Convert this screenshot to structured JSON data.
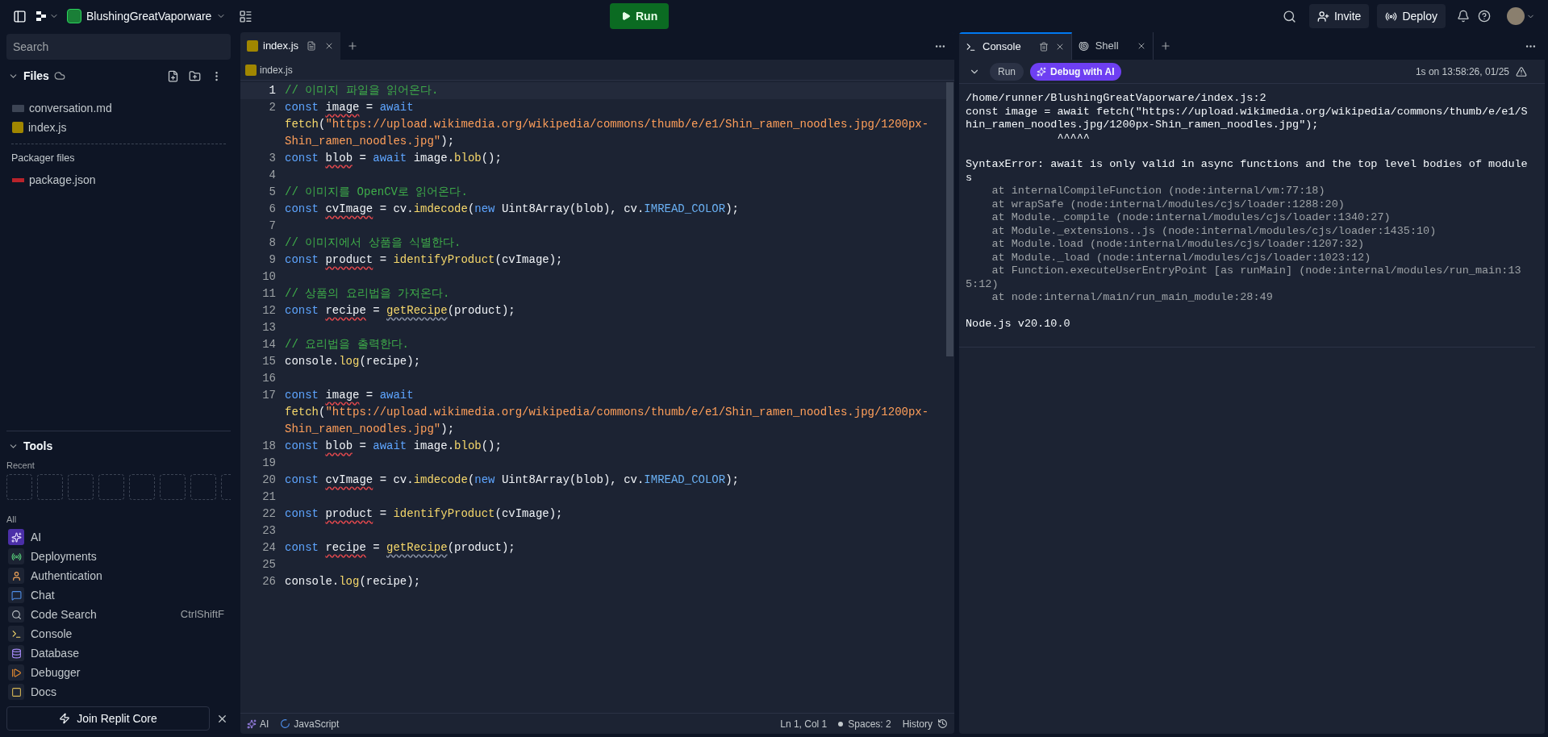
{
  "topbar": {
    "project_name": "BlushingGreatVaporware",
    "run_button": "Run",
    "invite_button": "Invite",
    "deploy_button": "Deploy"
  },
  "sidebar": {
    "search": {
      "placeholder": "Search"
    },
    "files_header": "Files",
    "files": [
      {
        "name": "conversation.md",
        "kind": "markdown"
      },
      {
        "name": "index.js",
        "kind": "js"
      }
    ],
    "packager_header": "Packager files",
    "packager_files": [
      {
        "name": "package.json",
        "kind": "npm"
      }
    ],
    "tools_header": "Tools",
    "recent_label": "Recent",
    "all_label": "All",
    "tools": [
      {
        "label": "AI"
      },
      {
        "label": "Deployments"
      },
      {
        "label": "Authentication"
      },
      {
        "label": "Chat"
      },
      {
        "label": "Code Search",
        "shortcut": "CtrlShiftF"
      },
      {
        "label": "Console"
      },
      {
        "label": "Database"
      },
      {
        "label": "Debugger"
      },
      {
        "label": "Docs"
      }
    ],
    "join_button": "Join Replit Core"
  },
  "editor": {
    "tabs": [
      {
        "label": "index.js",
        "selected": true
      }
    ],
    "breadcrumb": "index.js",
    "lines": [
      {
        "number": "1",
        "current": true,
        "tokens": [
          {
            "kind": "comment",
            "text": "// 이미지 파일을 읽어온다."
          }
        ]
      },
      {
        "number": "2",
        "current": false,
        "tokens": [
          {
            "kind": "keyword",
            "text": "const "
          },
          {
            "kind": "warn",
            "text": "image"
          },
          {
            "kind": "plain",
            "text": " = "
          },
          {
            "kind": "keyword",
            "text": "await "
          },
          {
            "kind": "function",
            "text": "fetch"
          },
          {
            "kind": "plain",
            "text": "("
          },
          {
            "kind": "string",
            "text": "\"https://upload.wikimedia.org/wikipedia/commons/thumb/e/e1/Shin_ramen_noodles.jpg/1200px-Shin_ramen_noodles.jpg\""
          },
          {
            "kind": "plain",
            "text": ");"
          }
        ]
      },
      {
        "number": "3",
        "current": false,
        "tokens": [
          {
            "kind": "keyword",
            "text": "const "
          },
          {
            "kind": "warn",
            "text": "blob"
          },
          {
            "kind": "plain",
            "text": " = "
          },
          {
            "kind": "keyword",
            "text": "await"
          },
          {
            "kind": "plain",
            "text": " image."
          },
          {
            "kind": "function",
            "text": "blob"
          },
          {
            "kind": "plain",
            "text": "();"
          }
        ]
      },
      {
        "number": "4",
        "current": false
      },
      {
        "number": "5",
        "current": false,
        "tokens": [
          {
            "kind": "comment",
            "text": "// 이미지를 OpenCV로 읽어온다."
          }
        ]
      },
      {
        "number": "6",
        "current": false,
        "tokens": [
          {
            "kind": "keyword",
            "text": "const "
          },
          {
            "kind": "warn",
            "text": "cvImage"
          },
          {
            "kind": "plain",
            "text": " = cv."
          },
          {
            "kind": "function",
            "text": "imdecode"
          },
          {
            "kind": "plain",
            "text": "("
          },
          {
            "kind": "keyword",
            "text": "new"
          },
          {
            "kind": "plain",
            "text": " Uint8Array(blob), cv."
          },
          {
            "kind": "property",
            "text": "IMREAD_COLOR"
          },
          {
            "kind": "plain",
            "text": ");"
          }
        ]
      },
      {
        "number": "7",
        "current": false
      },
      {
        "number": "8",
        "current": false,
        "tokens": [
          {
            "kind": "comment",
            "text": "// 이미지에서 상품을 식별한다."
          }
        ]
      },
      {
        "number": "9",
        "current": false,
        "tokens": [
          {
            "kind": "keyword",
            "text": "const "
          },
          {
            "kind": "warn",
            "text": "product"
          },
          {
            "kind": "plain",
            "text": " = "
          },
          {
            "kind": "function",
            "text": "identifyProduct"
          },
          {
            "kind": "plain",
            "text": "(cvImage);"
          }
        ]
      },
      {
        "number": "10",
        "current": false
      },
      {
        "number": "11",
        "current": false,
        "tokens": [
          {
            "kind": "comment",
            "text": "// 상품의 요리법을 가져온다."
          }
        ]
      },
      {
        "number": "12",
        "current": false,
        "tokens": [
          {
            "kind": "keyword",
            "text": "const "
          },
          {
            "kind": "warn",
            "text": "recipe"
          },
          {
            "kind": "plain",
            "text": " = "
          },
          {
            "kind": "hint",
            "text": "getRecipe"
          },
          {
            "kind": "plain",
            "text": "(product);"
          }
        ]
      },
      {
        "number": "13",
        "current": false
      },
      {
        "number": "14",
        "current": false,
        "tokens": [
          {
            "kind": "comment",
            "text": "// 요리법을 출력한다."
          }
        ]
      },
      {
        "number": "15",
        "current": false,
        "tokens": [
          {
            "kind": "plain",
            "text": "console."
          },
          {
            "kind": "function",
            "text": "log"
          },
          {
            "kind": "plain",
            "text": "(recipe);"
          }
        ]
      },
      {
        "number": "16",
        "current": false
      },
      {
        "number": "17",
        "current": false,
        "tokens": [
          {
            "kind": "keyword",
            "text": "const "
          },
          {
            "kind": "warn",
            "text": "image"
          },
          {
            "kind": "plain",
            "text": " = "
          },
          {
            "kind": "keyword",
            "text": "await "
          },
          {
            "kind": "function",
            "text": "fetch"
          },
          {
            "kind": "plain",
            "text": "("
          },
          {
            "kind": "string",
            "text": "\"https://upload.wikimedia.org/wikipedia/commons/thumb/e/e1/Shin_ramen_noodles.jpg/1200px-Shin_ramen_noodles.jpg\""
          },
          {
            "kind": "plain",
            "text": ");"
          }
        ]
      },
      {
        "number": "18",
        "current": false,
        "tokens": [
          {
            "kind": "keyword",
            "text": "const "
          },
          {
            "kind": "warn",
            "text": "blob"
          },
          {
            "kind": "plain",
            "text": " = "
          },
          {
            "kind": "keyword",
            "text": "await"
          },
          {
            "kind": "plain",
            "text": " image."
          },
          {
            "kind": "function",
            "text": "blob"
          },
          {
            "kind": "plain",
            "text": "();"
          }
        ]
      },
      {
        "number": "19",
        "current": false
      },
      {
        "number": "20",
        "current": false,
        "tokens": [
          {
            "kind": "keyword",
            "text": "const "
          },
          {
            "kind": "warn",
            "text": "cvImage"
          },
          {
            "kind": "plain",
            "text": " = cv."
          },
          {
            "kind": "function",
            "text": "imdecode"
          },
          {
            "kind": "plain",
            "text": "("
          },
          {
            "kind": "keyword",
            "text": "new"
          },
          {
            "kind": "plain",
            "text": " Uint8Array(blob), cv."
          },
          {
            "kind": "property",
            "text": "IMREAD_COLOR"
          },
          {
            "kind": "plain",
            "text": ");"
          }
        ]
      },
      {
        "number": "21",
        "current": false
      },
      {
        "number": "22",
        "current": false,
        "tokens": [
          {
            "kind": "keyword",
            "text": "const "
          },
          {
            "kind": "warn",
            "text": "product"
          },
          {
            "kind": "plain",
            "text": " = "
          },
          {
            "kind": "function",
            "text": "identifyProduct"
          },
          {
            "kind": "plain",
            "text": "(cvImage);"
          }
        ]
      },
      {
        "number": "23",
        "current": false
      },
      {
        "number": "24",
        "current": false,
        "tokens": [
          {
            "kind": "keyword",
            "text": "const "
          },
          {
            "kind": "warn",
            "text": "recipe"
          },
          {
            "kind": "plain",
            "text": " = "
          },
          {
            "kind": "hint",
            "text": "getRecipe"
          },
          {
            "kind": "plain",
            "text": "(product);"
          }
        ]
      },
      {
        "number": "25",
        "current": false
      },
      {
        "number": "26",
        "current": false,
        "tokens": [
          {
            "kind": "plain",
            "text": "console."
          },
          {
            "kind": "function",
            "text": "log"
          },
          {
            "kind": "plain",
            "text": "(recipe);"
          }
        ]
      }
    ],
    "status_bar": {
      "ai": "AI",
      "language": "JavaScript",
      "position": "Ln 1, Col 1",
      "spaces": "Spaces: 2",
      "history": "History"
    }
  },
  "console": {
    "tabs": [
      {
        "label": "Console",
        "kind": "console",
        "selected": true
      },
      {
        "label": "Shell",
        "kind": "shell",
        "selected": false
      }
    ],
    "run_button": "Run",
    "debug_button": "Debug with AI",
    "run_info": "1s on 13:58:26, 01/25",
    "output": [
      {
        "kind": "source",
        "text": "/home/runner/BlushingGreatVaporware/index.js:2"
      },
      {
        "kind": "source",
        "text": "const image = await fetch(\"https://upload.wikimedia.org/wikipedia/commons/thumb/e/e1/Shin_ramen_noodles.jpg/1200px-Shin_ramen_noodles.jpg\");"
      },
      {
        "kind": "pointer",
        "text": "              ^^^^^"
      },
      {
        "kind": "error",
        "text": "SyntaxError: await is only valid in async functions and the top level bodies of modules"
      },
      {
        "kind": "stack",
        "text": "    at internalCompileFunction (node:internal/vm:77:18)"
      },
      {
        "kind": "stack",
        "text": "    at wrapSafe (node:internal/modules/cjs/loader:1288:20)"
      },
      {
        "kind": "stack",
        "text": "    at Module._compile (node:internal/modules/cjs/loader:1340:27)"
      },
      {
        "kind": "stack",
        "text": "    at Module._extensions..js (node:internal/modules/cjs/loader:1435:10)"
      },
      {
        "kind": "stack",
        "text": "    at Module.load (node:internal/modules/cjs/loader:1207:32)"
      },
      {
        "kind": "stack",
        "text": "    at Module._load (node:internal/modules/cjs/loader:1023:12)"
      },
      {
        "kind": "stack",
        "text": "    at Function.executeUserEntryPoint [as runMain] (node:internal/modules/run_main:135:12)"
      },
      {
        "kind": "stack",
        "text": "    at node:internal/main/run_main_module:28:49"
      },
      {
        "kind": "version",
        "text": "Node.js v20.10.0"
      }
    ]
  }
}
